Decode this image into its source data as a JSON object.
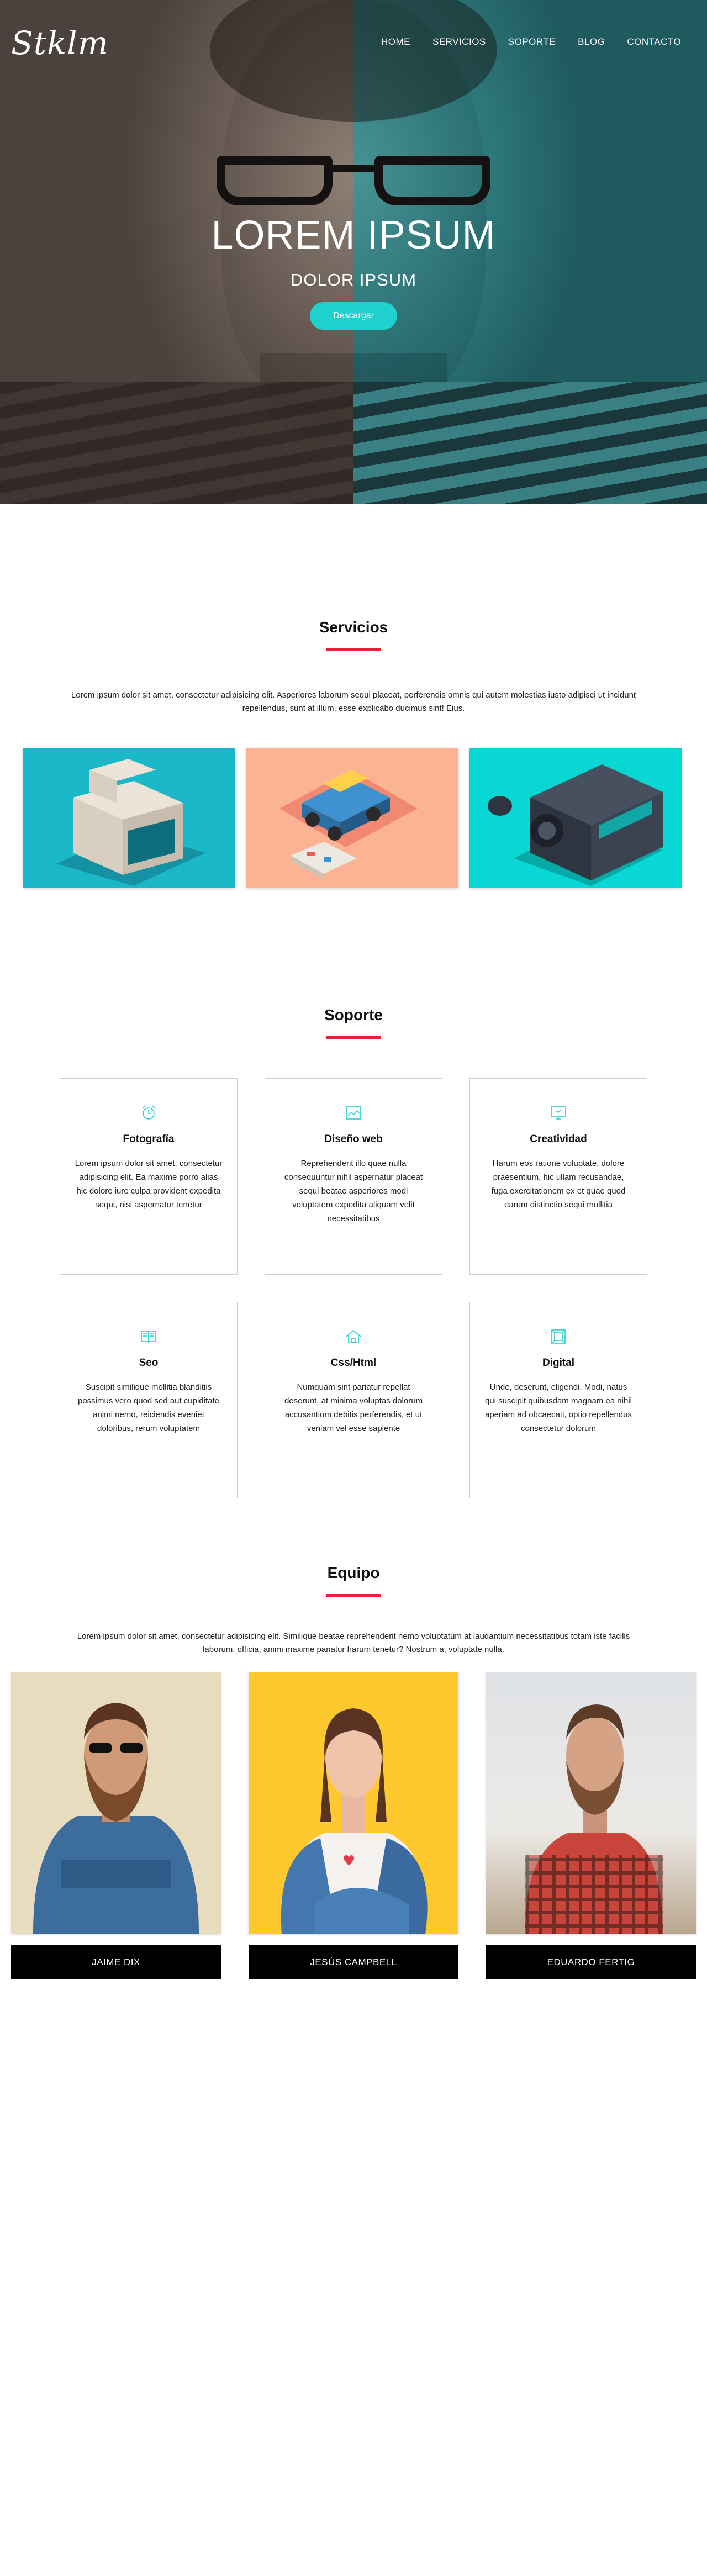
{
  "brand": {
    "logo": "Stklm"
  },
  "nav": {
    "items": [
      "HOME",
      "SERVICIOS",
      "SOPORTE",
      "BLOG",
      "CONTACTO"
    ]
  },
  "hero": {
    "title": "LOREM IPSUM",
    "subtitle": "DOLOR IPSUM",
    "button": "Descargar"
  },
  "servicios": {
    "title": "Servicios",
    "text": "Lorem ipsum dolor sit amet, consectetur adipisicing elit. Asperiores laborum sequi placeat, perferendis omnis qui autem molestias iusto adipisci ut incidunt repellendus, sunt at illum, esse explicabo ducimus sint! Eius.",
    "cards": [
      {
        "icon": "retro-computer-icon",
        "bg": "#1bb8c9"
      },
      {
        "icon": "toy-truck-icon",
        "bg": "#fbb393"
      },
      {
        "icon": "video-camera-icon",
        "bg": "#08d7d3"
      }
    ]
  },
  "soporte": {
    "title": "Soporte",
    "items": [
      {
        "title": "Fotografía",
        "text": "Lorem ipsum dolor sit amet, consectetur adipisicing elit. Ea maxime porro alias hic dolore iure culpa provident expedita sequi, nisi aspernatur tenetur",
        "icon": "alarm-clock-icon"
      },
      {
        "title": "Diseño web",
        "text": "Reprehenderit illo quae nulla consequuntur nihil aspernatur placeat sequi beatae asperiores modi voluptatem expedita aliquam velit necessitatibus",
        "icon": "image-icon"
      },
      {
        "title": "Creatividad",
        "text": "Harum eos ratione voluptate, dolore praesentium, hic ullam recusandae, fuga exercitationem ex et quae quod earum distinctio sequi mollitia",
        "icon": "monitor-icon"
      },
      {
        "title": "Seo",
        "text": "Suscipit similique mollitia blanditiis possimus vero quod sed aut cupiditate animi nemo, reiciendis eveniet doloribus, rerum voluptatem",
        "icon": "book-icon"
      },
      {
        "title": "Css/Html",
        "text": "Numquam sint pariatur repellat deserunt, at minima voluptas dolorum accusantium debitis perferendis, et ut veniam vel esse sapiente",
        "icon": "home-icon"
      },
      {
        "title": "Digital",
        "text": "Unde, deserunt, eligendi. Modi, natus qui suscipit quibusdam magnam ea nihil aperiam ad obcaecati, optio repellendus consectetur dolorum",
        "icon": "frame-icon"
      }
    ]
  },
  "equipo": {
    "title": "Equipo",
    "text": "Lorem ipsum dolor sit amet, consectetur adipisicing elit. Similique beatae reprehenderit nemo voluptatum at laudantium necessitatibus totam iste facilis laborum, officia, animi maxime pariatur harum tenetur? Nostrum a, voluptate nulla.",
    "members": [
      {
        "name": "JAIME DIX",
        "bg": "#e8dcbf"
      },
      {
        "name": "JESÚS CAMPBELL",
        "bg": "#fdc92e"
      },
      {
        "name": "EDUARDO FERTIG",
        "bg": "#e9ebed"
      }
    ]
  },
  "colors": {
    "accent": "#1fd0cf",
    "underline": "#e81d39"
  }
}
